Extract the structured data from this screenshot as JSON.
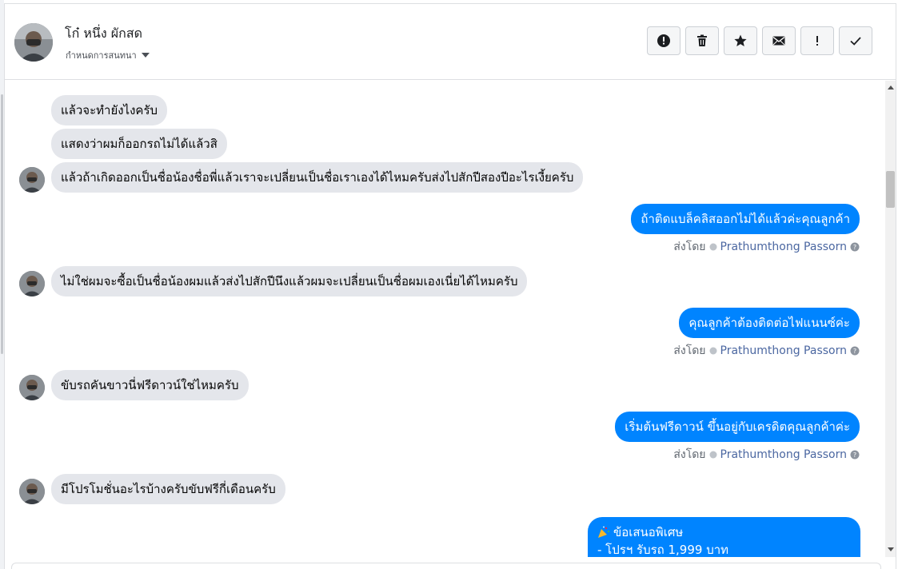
{
  "header": {
    "contact_name": "โก๋ หนึ่ง ผักสด",
    "assign_label": "กำหนดการสนทนา",
    "actions": [
      {
        "name": "report-spam-button",
        "icon": "alert-circle-icon"
      },
      {
        "name": "delete-button",
        "icon": "trash-icon"
      },
      {
        "name": "star-button",
        "icon": "star-icon"
      },
      {
        "name": "mark-unread-button",
        "icon": "envelope-icon"
      },
      {
        "name": "follow-up-button",
        "icon": "exclamation-icon"
      },
      {
        "name": "mark-done-button",
        "icon": "check-icon"
      }
    ]
  },
  "messages": [
    {
      "dir": "in",
      "text": "แล้วจะทำยังไงครับ"
    },
    {
      "dir": "in",
      "text": "แสดงว่าผมก็ออกรถไม่ได้แล้วสิ"
    },
    {
      "dir": "in",
      "text": "แล้วถ้าเกิดออกเป็นชื่อน้องชื่อพี่แล้วเราจะเปลี่ยนเป็นชื่อเราเองได้ไหมครับส่งไปสักปีสองปีอะไรเงี้ยครับ"
    },
    {
      "dir": "out",
      "text": "ถ้าติดแบล็คลิสออกไม่ได้แล้วค่ะคุณลูกค้า"
    },
    {
      "dir": "in",
      "text": "ไม่ใช่ผมจะซื้อเป็นชื่อน้องผมแล้วส่งไปสักปีนึงแล้วผมจะเปลี่ยนเป็นชื่อผมเองเนี่ยได้ไหมครับ"
    },
    {
      "dir": "out",
      "text": "คุณลูกค้าต้องติดต่อไฟแนนซ์ค่ะ"
    },
    {
      "dir": "in",
      "text": "ขับรถคันขาวนี่ฟรีดาวน์ใช่ไหมครับ"
    },
    {
      "dir": "out",
      "text": "เริ่มต้นฟรีดาวน์ ขึ้นอยู่กับเครดิตคุณลูกค้าค่ะ"
    },
    {
      "dir": "in",
      "text": "มีโปรโมชั่นอะไรบ้างครับขับฟรีกี่เดือนครับ"
    }
  ],
  "sent_by": {
    "prefix": "ส่งโดย",
    "agent": "Prathumthong Passorn"
  },
  "promo": {
    "line1": "ข้อเสนอพิเศษ",
    "line2": "- โปรฯ รับรถ 1,999 บาท",
    "icon": "party-popper-icon"
  },
  "colors": {
    "outgoing": "#0084ff",
    "incoming": "#e4e6eb",
    "agent_name": "#4b67a1"
  }
}
